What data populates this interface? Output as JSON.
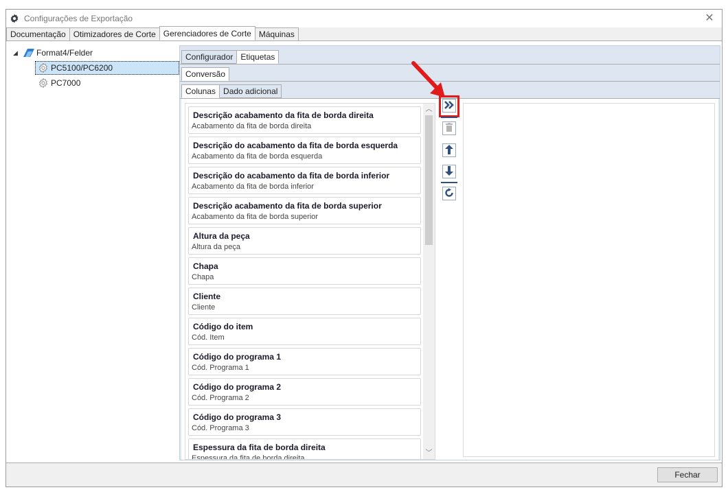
{
  "window": {
    "title": "Configurações de Exportação"
  },
  "main_tabs": [
    {
      "label": "Documentação",
      "active": false
    },
    {
      "label": "Otimizadores de Corte",
      "active": false
    },
    {
      "label": "Gerenciadores de Corte",
      "active": true
    },
    {
      "label": "Máquinas",
      "active": false
    }
  ],
  "tree": {
    "root": {
      "label": "Format4/Felder",
      "icon": "format4-logo-icon",
      "expanded": true
    },
    "children": [
      {
        "label": "PC5100/PC6200",
        "icon": "gear-icon",
        "selected": true
      },
      {
        "label": "PC7000",
        "icon": "gear-icon",
        "selected": false
      }
    ]
  },
  "panel_tabs": [
    {
      "label": "Configurador",
      "active": false
    },
    {
      "label": "Etiquetas",
      "active": true
    }
  ],
  "sub_tab": {
    "label": "Conversão"
  },
  "column_tabs": [
    {
      "label": "Colunas",
      "active": true
    },
    {
      "label": "Dado adicional",
      "active": false
    }
  ],
  "columns_list": [
    {
      "title": "Descrição acabamento da fita de borda direita",
      "subtitle": "Acabamento da fita de borda direita"
    },
    {
      "title": "Descrição do acabamento da fita de borda esquerda",
      "subtitle": "Acabamento da fita de borda esquerda"
    },
    {
      "title": "Descrição do acabamento da fita de borda inferior",
      "subtitle": "Acabamento da fita de borda inferior"
    },
    {
      "title": "Descrição acabamento da fita de borda superior",
      "subtitle": "Acabamento da fita de borda superior"
    },
    {
      "title": "Altura da peça",
      "subtitle": "Altura da peça"
    },
    {
      "title": "Chapa",
      "subtitle": "Chapa"
    },
    {
      "title": "Cliente",
      "subtitle": "Cliente"
    },
    {
      "title": "Código do item",
      "subtitle": "Cód. Item"
    },
    {
      "title": "Código do programa 1",
      "subtitle": "Cód. Programa 1"
    },
    {
      "title": "Código do programa 2",
      "subtitle": "Cód. Programa 2"
    },
    {
      "title": "Código do programa 3",
      "subtitle": "Cód. Programa 3"
    },
    {
      "title": "Espessura da fita de borda direita",
      "subtitle": "Espessura da fita de borda direita"
    }
  ],
  "toolbar": {
    "add_all": {
      "icon": "double-chevron-right-icon"
    },
    "delete": {
      "icon": "trash-icon"
    },
    "move_up": {
      "icon": "arrow-up-icon"
    },
    "move_down": {
      "icon": "arrow-down-icon"
    },
    "reset": {
      "icon": "refresh-icon"
    }
  },
  "footer": {
    "close_label": "Fechar"
  },
  "colors": {
    "accent_blue": "#2f4f7f",
    "panel_bg": "#dde6f1",
    "annotation_red": "#e01b1b"
  }
}
